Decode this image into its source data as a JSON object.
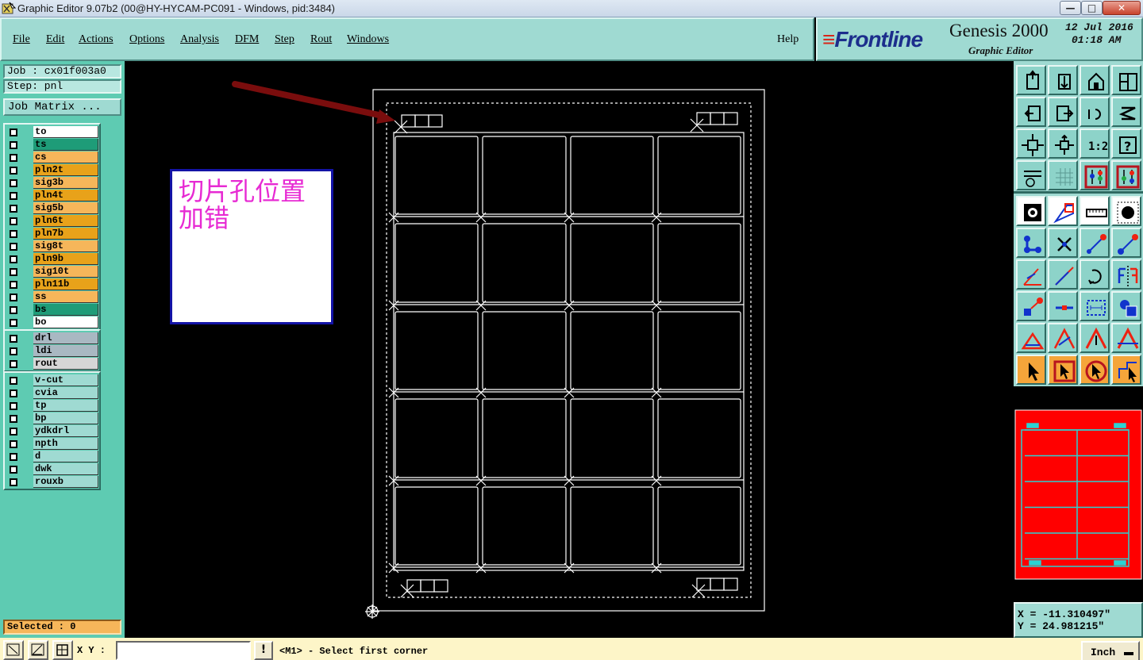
{
  "window": {
    "title": "Graphic Editor 9.07b2 (00@HY-HYCAM-PC091 - Windows, pid:3484)",
    "controls": {
      "minimize": "—",
      "maximize": "□",
      "close": "✕"
    }
  },
  "menu": {
    "items": [
      "File",
      "Edit",
      "Actions",
      "Options",
      "Analysis",
      "DFM",
      "Step",
      "Rout",
      "Windows"
    ],
    "help": "Help"
  },
  "branding": {
    "logo": "Frontline",
    "product": "Genesis 2000",
    "subtitle": "Graphic Editor",
    "date": "12 Jul 2016",
    "time": "01:18 AM",
    "colors": {
      "logo_text": "#1c2e8c",
      "logo_lines": "#d8261a"
    }
  },
  "job": {
    "job_label": "Job : cx01f003a0",
    "step_label": "Step: pnl",
    "matrix_button": "Job Matrix ..."
  },
  "layers": {
    "board": [
      {
        "name": "to",
        "color": "#ffffff"
      },
      {
        "name": "ts",
        "color": "#1e9c78"
      },
      {
        "name": "cs",
        "color": "#f6b65a"
      },
      {
        "name": "pln2t",
        "color": "#e8a21a"
      },
      {
        "name": "sig3b",
        "color": "#f6b65a"
      },
      {
        "name": "pln4t",
        "color": "#e8a21a"
      },
      {
        "name": "sig5b",
        "color": "#f6b65a"
      },
      {
        "name": "pln6t",
        "color": "#e8a21a"
      },
      {
        "name": "pln7b",
        "color": "#e8a21a"
      },
      {
        "name": "sig8t",
        "color": "#f6b65a"
      },
      {
        "name": "pln9b",
        "color": "#e8a21a"
      },
      {
        "name": "sig10t",
        "color": "#f6b65a"
      },
      {
        "name": "pln11b",
        "color": "#e8a21a"
      },
      {
        "name": "ss",
        "color": "#f6b65a"
      },
      {
        "name": "bs",
        "color": "#1e9c78"
      },
      {
        "name": "bo",
        "color": "#ffffff"
      }
    ],
    "drill": [
      {
        "name": "drl",
        "color": "#a9b8c2"
      },
      {
        "name": "ldi",
        "color": "#a9b8c2"
      },
      {
        "name": "rout",
        "color": "#d6d6d6"
      }
    ],
    "misc": [
      {
        "name": "v-cut",
        "color": "#9fdad2"
      },
      {
        "name": "cvia",
        "color": "#9fdad2"
      },
      {
        "name": "tp",
        "color": "#9fdad2"
      },
      {
        "name": "bp",
        "color": "#9fdad2"
      },
      {
        "name": "ydkdrl",
        "color": "#9fdad2"
      },
      {
        "name": "npth",
        "color": "#9fdad2"
      },
      {
        "name": "d",
        "color": "#9fdad2"
      },
      {
        "name": "dwk",
        "color": "#9fdad2"
      },
      {
        "name": "rouxb",
        "color": "#9fdad2"
      }
    ]
  },
  "status": {
    "selected": "Selected : 0"
  },
  "annotation": {
    "text": "切片孔位置\n加错",
    "text_color": "#e72ad3",
    "border_color": "#1313a6",
    "arrow_color": "#7a0d0d"
  },
  "panel": {
    "rows": 5,
    "cols": 4,
    "outline_color": "#ffffff"
  },
  "tools": {
    "view": [
      "zoom-home-icon",
      "zoom-page-icon",
      "zoom-house-icon",
      "window-layout-icon",
      "pan-left-icon",
      "pan-right-icon",
      "undo-view-icon",
      "redo-view-icon",
      "fit-all-icon",
      "center-icon",
      "scale-1-2-icon",
      "help-question-icon",
      "options-tools-icon",
      "grid-icon",
      "layer-colors-icon",
      "layer-colors-alt-icon"
    ],
    "edit": [
      "snap-point-icon",
      "transform-icon",
      "ruler-icon",
      "pad-icon",
      "nodes-icon",
      "cross-icon",
      "connect-icon",
      "connect-alt-icon",
      "line-draw-icon",
      "line-angle-icon",
      "rotate-icon",
      "mirror-icon",
      "pad-move-icon",
      "line-cut-icon",
      "measure-box-icon",
      "shapes-icon",
      "triangle-small-icon",
      "triangle-icon",
      "triangle-arrow-icon",
      "triangle-split-icon",
      "select-arrow-icon",
      "select-box-icon",
      "select-circle-icon",
      "select-path-icon"
    ]
  },
  "coords": {
    "x": "X = -11.310497\"",
    "y": "Y = 24.981215\""
  },
  "bottom": {
    "xy_label": "X Y :",
    "xy_value": "",
    "warn": "!",
    "prompt": "<M1> - Select first corner",
    "units": "Inch"
  }
}
